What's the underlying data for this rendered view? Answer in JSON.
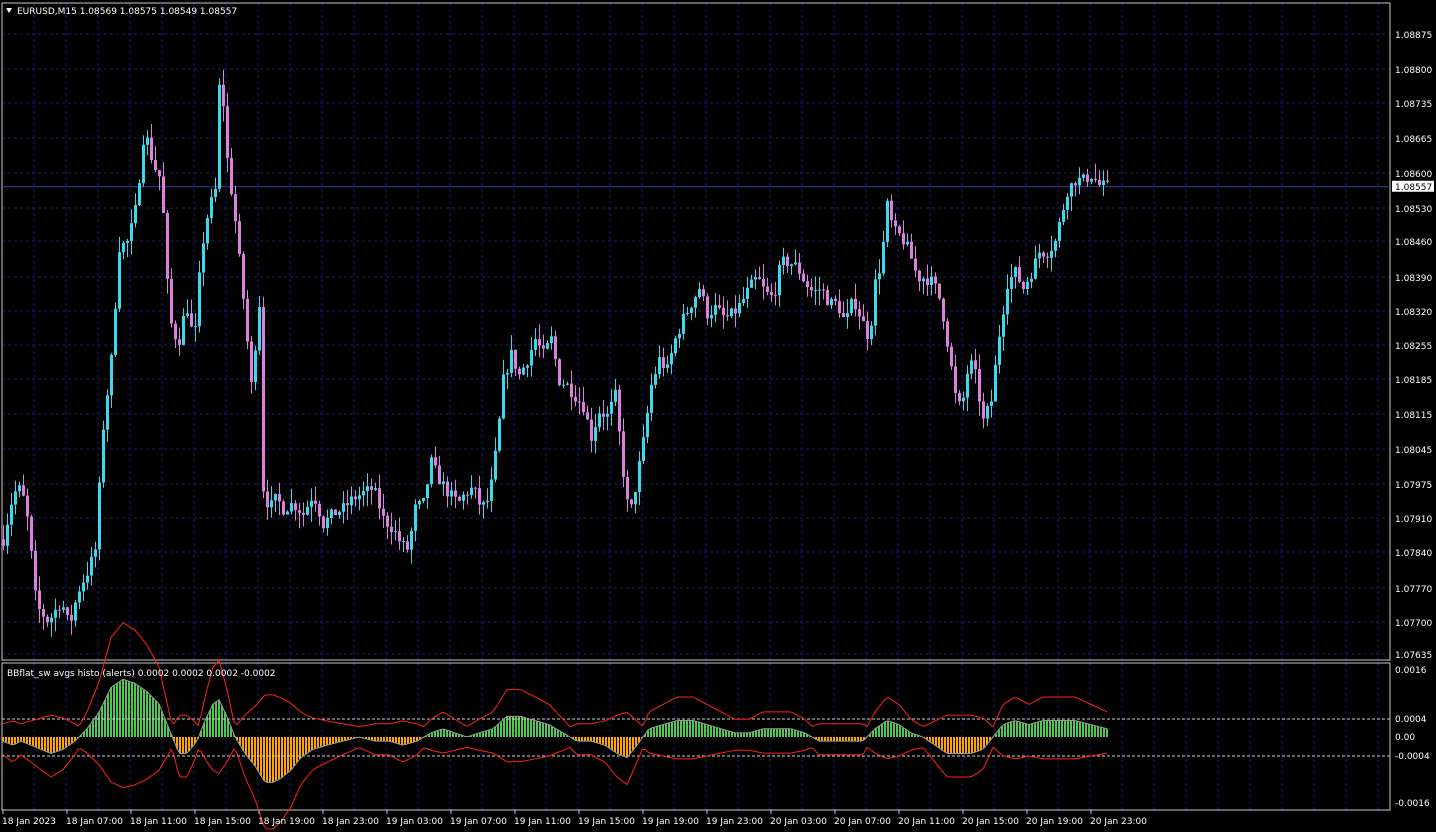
{
  "colors": {
    "background": "#000000",
    "grid": "#1a1f6b",
    "frame": "#c8c8c8",
    "axis_text": "#ffffff",
    "bull_candle": "#3fd8e8",
    "bear_candle": "#d882d8",
    "price_line": "#3a3f9a",
    "histo_up": "#4fc84f",
    "histo_down": "#ffa500",
    "bands": "#ff2020",
    "level_lines": "#d0d0d0",
    "avg_line": "#9a9a9a"
  },
  "main_chart": {
    "header": "EURUSD,M15  1.08569 1.08575 1.08549 1.08557",
    "header_icon": "triangle-down-icon",
    "current_price": "1.08557",
    "price_axis_labels": [
      "1.08875",
      "1.08800",
      "1.08735",
      "1.08665",
      "1.08600",
      "1.08530",
      "1.08460",
      "1.08390",
      "1.08320",
      "1.08255",
      "1.08185",
      "1.08115",
      "1.08045",
      "1.07975",
      "1.07910",
      "1.07840",
      "1.07770",
      "1.07700",
      "1.07635"
    ]
  },
  "indicator": {
    "header": "BBflat_sw avgs histo (alerts) 0.0002 0.0002 0.0002 -0.0002",
    "axis_labels": [
      "0.0016",
      "0.0004",
      "0.00",
      "-0.0004",
      "-0.0016"
    ]
  },
  "time_axis": {
    "labels": [
      "18 Jan 2023",
      "18 Jan 07:00",
      "18 Jan 11:00",
      "18 Jan 15:00",
      "18 Jan 19:00",
      "18 Jan 23:00",
      "19 Jan 03:00",
      "19 Jan 07:00",
      "19 Jan 11:00",
      "19 Jan 15:00",
      "19 Jan 19:00",
      "19 Jan 23:00",
      "20 Jan 03:00",
      "20 Jan 07:00",
      "20 Jan 11:00",
      "20 Jan 15:00",
      "20 Jan 19:00",
      "20 Jan 23:00"
    ]
  },
  "chart_data": [
    {
      "type": "candlestick",
      "title": "EURUSD,M15",
      "ylim": [
        1.07635,
        1.08915
      ],
      "anchors": [
        [
          0,
          1.0787
        ],
        [
          10,
          1.0796
        ],
        [
          18,
          1.0797
        ],
        [
          25,
          1.079
        ],
        [
          33,
          1.0774
        ],
        [
          45,
          1.0771
        ],
        [
          58,
          1.0775
        ],
        [
          66,
          1.077
        ],
        [
          75,
          1.0777
        ],
        [
          85,
          1.0781
        ],
        [
          92,
          1.0785
        ],
        [
          100,
          1.0809
        ],
        [
          108,
          1.0822
        ],
        [
          116,
          1.0844
        ],
        [
          125,
          1.0845
        ],
        [
          133,
          1.0852
        ],
        [
          141,
          1.0867
        ],
        [
          150,
          1.086
        ],
        [
          158,
          1.0857
        ],
        [
          166,
          1.083
        ],
        [
          175,
          1.0825
        ],
        [
          183,
          1.0833
        ],
        [
          191,
          1.0825
        ],
        [
          198,
          1.0843
        ],
        [
          205,
          1.0851
        ],
        [
          212,
          1.0855
        ],
        [
          217,
          1.088
        ],
        [
          224,
          1.0861
        ],
        [
          232,
          1.0849
        ],
        [
          240,
          1.0834
        ],
        [
          248,
          1.0817
        ],
        [
          256,
          1.0833
        ],
        [
          260,
          1.0797
        ],
        [
          266,
          1.0793
        ],
        [
          273,
          1.0795
        ],
        [
          280,
          1.0793
        ],
        [
          290,
          1.0794
        ],
        [
          300,
          1.0792
        ],
        [
          310,
          1.0796
        ],
        [
          320,
          1.079
        ],
        [
          330,
          1.0792
        ],
        [
          340,
          1.0793
        ],
        [
          350,
          1.0795
        ],
        [
          360,
          1.0796
        ],
        [
          370,
          1.0797
        ],
        [
          380,
          1.0791
        ],
        [
          390,
          1.0789
        ],
        [
          398,
          1.0786
        ],
        [
          405,
          1.0785
        ],
        [
          412,
          1.0793
        ],
        [
          420,
          1.0794
        ],
        [
          428,
          1.0802
        ],
        [
          435,
          1.0799
        ],
        [
          445,
          1.0796
        ],
        [
          455,
          1.0794
        ],
        [
          462,
          1.0796
        ],
        [
          470,
          1.0797
        ],
        [
          478,
          1.0793
        ],
        [
          486,
          1.0795
        ],
        [
          494,
          1.0806
        ],
        [
          500,
          1.0818
        ],
        [
          508,
          1.0823
        ],
        [
          516,
          1.0819
        ],
        [
          524,
          1.0822
        ],
        [
          532,
          1.0826
        ],
        [
          540,
          1.0823
        ],
        [
          548,
          1.0826
        ],
        [
          556,
          1.0818
        ],
        [
          564,
          1.0817
        ],
        [
          572,
          1.0815
        ],
        [
          580,
          1.0813
        ],
        [
          588,
          1.0807
        ],
        [
          596,
          1.0812
        ],
        [
          604,
          1.0811
        ],
        [
          612,
          1.0815
        ],
        [
          620,
          1.08
        ],
        [
          626,
          1.0791
        ],
        [
          632,
          1.0797
        ],
        [
          640,
          1.0806
        ],
        [
          648,
          1.0817
        ],
        [
          656,
          1.0822
        ],
        [
          664,
          1.082
        ],
        [
          672,
          1.0826
        ],
        [
          680,
          1.083
        ],
        [
          688,
          1.0833
        ],
        [
          696,
          1.0836
        ],
        [
          704,
          1.0831
        ],
        [
          712,
          1.0832
        ],
        [
          722,
          1.083
        ],
        [
          730,
          1.0831
        ],
        [
          738,
          1.0833
        ],
        [
          746,
          1.0836
        ],
        [
          754,
          1.0838
        ],
        [
          762,
          1.0835
        ],
        [
          770,
          1.0834
        ],
        [
          778,
          1.0841
        ],
        [
          786,
          1.0841
        ],
        [
          794,
          1.084
        ],
        [
          802,
          1.0837
        ],
        [
          810,
          1.0835
        ],
        [
          818,
          1.0836
        ],
        [
          826,
          1.0833
        ],
        [
          834,
          1.0833
        ],
        [
          842,
          1.0829
        ],
        [
          850,
          1.0834
        ],
        [
          858,
          1.083
        ],
        [
          866,
          1.0826
        ],
        [
          872,
          1.0837
        ],
        [
          878,
          1.0841
        ],
        [
          884,
          1.0852
        ],
        [
          890,
          1.0847
        ],
        [
          898,
          1.0846
        ],
        [
          906,
          1.0843
        ],
        [
          914,
          1.0838
        ],
        [
          922,
          1.0838
        ],
        [
          930,
          1.0837
        ],
        [
          938,
          1.0833
        ],
        [
          946,
          1.0823
        ],
        [
          952,
          1.0815
        ],
        [
          958,
          1.0812
        ],
        [
          966,
          1.0822
        ],
        [
          972,
          1.0819
        ],
        [
          980,
          1.081
        ],
        [
          988,
          1.0814
        ],
        [
          996,
          1.0827
        ],
        [
          1004,
          1.0837
        ],
        [
          1012,
          1.0839
        ],
        [
          1020,
          1.0836
        ],
        [
          1028,
          1.0839
        ],
        [
          1036,
          1.0843
        ],
        [
          1044,
          1.0843
        ],
        [
          1052,
          1.0845
        ],
        [
          1058,
          1.085
        ],
        [
          1064,
          1.0855
        ],
        [
          1072,
          1.0857
        ],
        [
          1080,
          1.0857
        ],
        [
          1088,
          1.0858
        ],
        [
          1096,
          1.0856
        ],
        [
          1104,
          1.08557
        ]
      ]
    },
    {
      "type": "bar",
      "title": "BBflat_sw avgs histo (alerts)",
      "ylim": [
        -0.0016,
        0.0016
      ],
      "levels": [
        0.0004,
        -0.0004
      ],
      "anchors": [
        [
          0,
          -0.0001
        ],
        [
          10,
          -0.0002
        ],
        [
          18,
          -0.0001
        ],
        [
          28,
          -0.0002
        ],
        [
          38,
          -0.0003
        ],
        [
          48,
          -0.0004
        ],
        [
          60,
          -0.0003
        ],
        [
          72,
          -0.0001
        ],
        [
          84,
          0.0002
        ],
        [
          96,
          0.0006
        ],
        [
          108,
          0.0012
        ],
        [
          120,
          0.0014
        ],
        [
          132,
          0.0013
        ],
        [
          144,
          0.0011
        ],
        [
          156,
          0.0008
        ],
        [
          166,
          0.0002
        ],
        [
          176,
          -0.0004
        ],
        [
          184,
          -0.0004
        ],
        [
          194,
          -0.0001
        ],
        [
          202,
          0.0004
        ],
        [
          210,
          0.0008
        ],
        [
          216,
          0.0009
        ],
        [
          224,
          0.0005
        ],
        [
          232,
          0.0
        ],
        [
          242,
          -0.0004
        ],
        [
          252,
          -0.0007
        ],
        [
          262,
          -0.0011
        ],
        [
          270,
          -0.0011
        ],
        [
          278,
          -0.001
        ],
        [
          288,
          -0.0008
        ],
        [
          298,
          -0.0005
        ],
        [
          310,
          -0.0003
        ],
        [
          324,
          -0.0002
        ],
        [
          340,
          -0.0001
        ],
        [
          356,
          0.0
        ],
        [
          372,
          -0.0001
        ],
        [
          386,
          -0.0001
        ],
        [
          400,
          -0.0002
        ],
        [
          414,
          -0.0001
        ],
        [
          428,
          0.0001
        ],
        [
          440,
          0.0002
        ],
        [
          452,
          0.0001
        ],
        [
          464,
          0.0
        ],
        [
          476,
          0.0001
        ],
        [
          490,
          0.0002
        ],
        [
          504,
          0.0005
        ],
        [
          518,
          0.0005
        ],
        [
          532,
          0.0004
        ],
        [
          546,
          0.0003
        ],
        [
          560,
          0.0001
        ],
        [
          574,
          -0.0001
        ],
        [
          588,
          -0.0001
        ],
        [
          602,
          -0.0002
        ],
        [
          614,
          -0.0004
        ],
        [
          624,
          -0.0005
        ],
        [
          634,
          -0.0002
        ],
        [
          646,
          0.0002
        ],
        [
          660,
          0.0003
        ],
        [
          674,
          0.0004
        ],
        [
          690,
          0.0004
        ],
        [
          704,
          0.0003
        ],
        [
          718,
          0.0002
        ],
        [
          732,
          0.0001
        ],
        [
          746,
          0.0001
        ],
        [
          760,
          0.0002
        ],
        [
          774,
          0.0002
        ],
        [
          788,
          0.0002
        ],
        [
          802,
          0.0001
        ],
        [
          816,
          -0.0001
        ],
        [
          830,
          -0.0001
        ],
        [
          846,
          -0.0001
        ],
        [
          860,
          -0.0001
        ],
        [
          872,
          0.0002
        ],
        [
          884,
          0.0004
        ],
        [
          896,
          0.0003
        ],
        [
          908,
          0.0001
        ],
        [
          920,
          0.0
        ],
        [
          932,
          -0.0002
        ],
        [
          944,
          -0.0004
        ],
        [
          956,
          -0.0004
        ],
        [
          968,
          -0.0004
        ],
        [
          980,
          -0.0003
        ],
        [
          990,
          0.0
        ],
        [
          1000,
          0.0003
        ],
        [
          1012,
          0.0004
        ],
        [
          1026,
          0.0003
        ],
        [
          1040,
          0.0004
        ],
        [
          1056,
          0.0004
        ],
        [
          1072,
          0.0004
        ],
        [
          1088,
          0.0003
        ],
        [
          1104,
          0.0002
        ]
      ]
    }
  ]
}
